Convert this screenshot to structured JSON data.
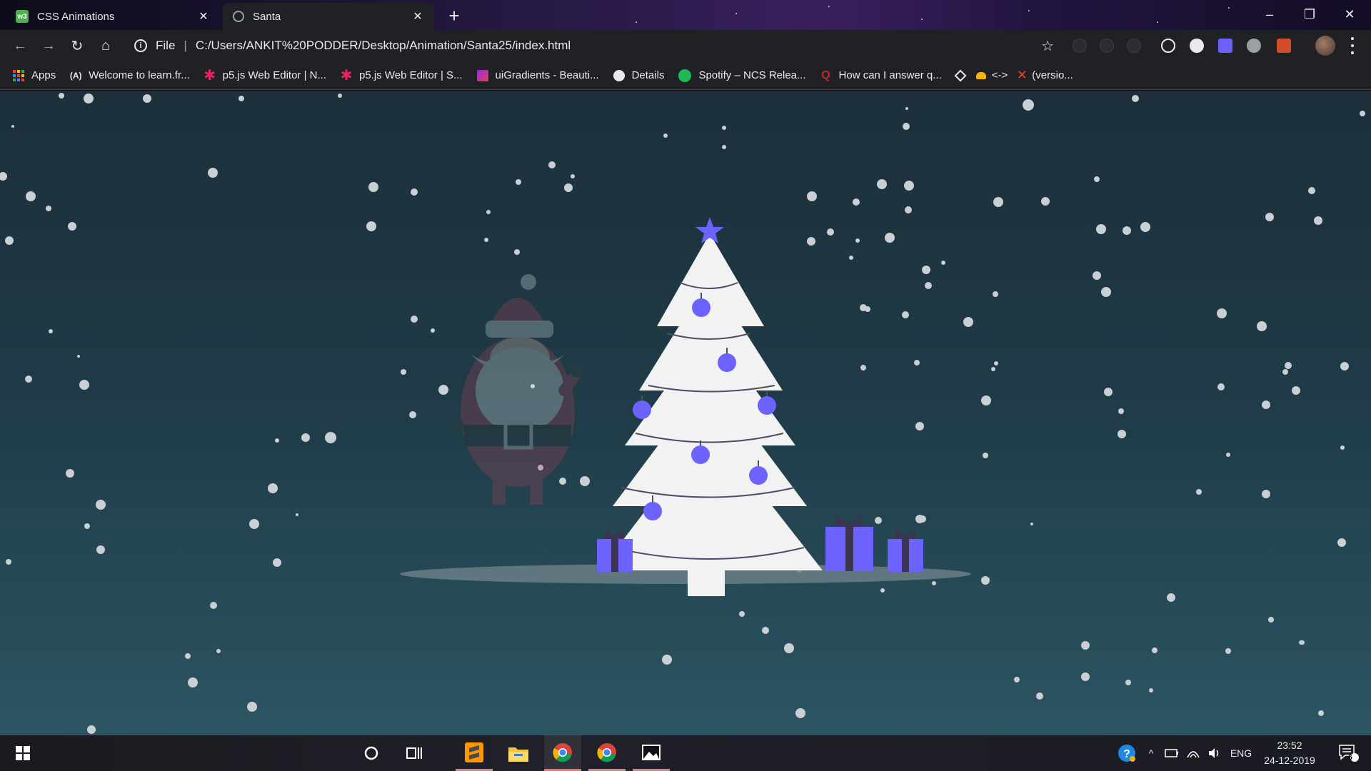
{
  "browser": {
    "tabs": [
      {
        "title": "CSS Animations",
        "favicon": "w3schools-icon",
        "active": false
      },
      {
        "title": "Santa",
        "favicon": "globe-icon",
        "active": true
      }
    ],
    "new_tab_label": "+",
    "window_controls": {
      "minimize": "–",
      "maximize": "❐",
      "close": "✕"
    }
  },
  "toolbar": {
    "back": "←",
    "forward": "→",
    "reload": "↻",
    "home": "⌂",
    "scheme": "File",
    "separator": "|",
    "url": "C:/Users/ANKIT%20PODDER/Desktop/Animation/Santa25/index.html",
    "bookmark_star": "☆"
  },
  "bookmarks": [
    {
      "label": "Apps",
      "icon": "apps-grid-icon"
    },
    {
      "label": "Welcome to learn.fr...",
      "icon": "freecodecamp-icon"
    },
    {
      "label": "p5.js Web Editor | N...",
      "icon": "p5js-icon"
    },
    {
      "label": "p5.js Web Editor | S...",
      "icon": "p5js-icon"
    },
    {
      "label": "uiGradients - Beauti...",
      "icon": "uigradients-icon"
    },
    {
      "label": "Details",
      "icon": "globe-icon"
    },
    {
      "label": "Spotify – NCS Relea...",
      "icon": "spotify-icon"
    },
    {
      "label": "How can I answer q...",
      "icon": "quora-icon"
    },
    {
      "label": "",
      "icon": "codepen-icon"
    },
    {
      "label": "<->",
      "icon": "hat-icon"
    },
    {
      "label": "(versio...",
      "icon": "x-icon"
    }
  ],
  "scene": {
    "background_top": "#1c2f3a",
    "background_bottom": "#2c5563",
    "tree_color": "#f2f2f2",
    "ornament_color": "#6c63ff",
    "gift_color": "#6c63ff",
    "santa_opacity": 0.25
  },
  "taskbar": {
    "language": "ENG",
    "time": "23:52",
    "date": "24-12-2019",
    "notification_count": "6"
  },
  "colors": {
    "chrome_dark": "#202124",
    "accent_purple": "#6c63ff"
  }
}
